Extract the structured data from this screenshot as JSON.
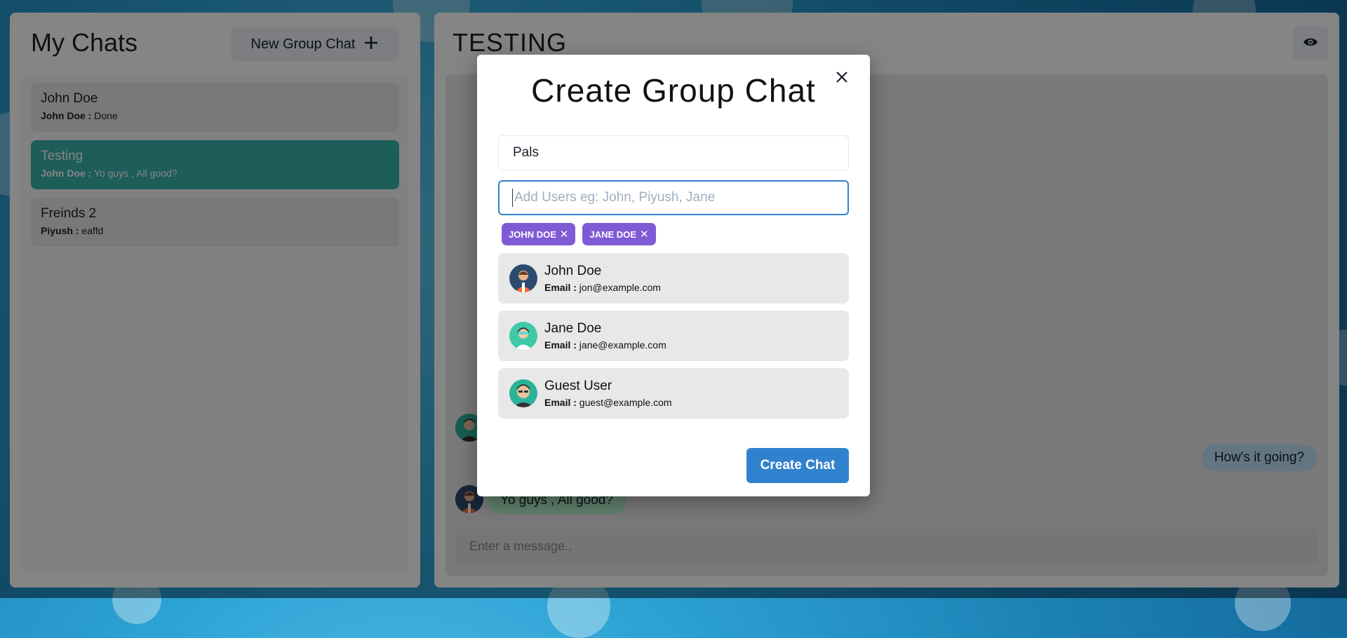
{
  "sidebar": {
    "title": "My Chats",
    "new_group_button": "New Group Chat",
    "chats": [
      {
        "name": "John Doe",
        "sender": "John Doe :",
        "message": "Done"
      },
      {
        "name": "Testing",
        "sender": "John Doe :",
        "message": "Yo guys , All good?"
      },
      {
        "name": "Freinds 2",
        "sender": "Piyush :",
        "message": "eaffd"
      }
    ]
  },
  "chatbox": {
    "title": "TESTING",
    "messages": [
      {
        "text": "How's it going?"
      },
      {
        "text": "Yo guys , All good?"
      }
    ],
    "input_placeholder": "Enter a message.."
  },
  "modal": {
    "title": "Create Group Chat",
    "chat_name_value": "Pals",
    "users_placeholder": "Add Users eg: John, Piyush, Jane",
    "selected_users": [
      {
        "label": "JOHN DOE"
      },
      {
        "label": "JANE DOE"
      }
    ],
    "search_results": [
      {
        "name": "John Doe",
        "email_label": "Email :",
        "email": "jon@example.com"
      },
      {
        "name": "Jane Doe",
        "email_label": "Email :",
        "email": "jane@example.com"
      },
      {
        "name": "Guest User",
        "email_label": "Email :",
        "email": "guest@example.com"
      }
    ],
    "create_button": "Create Chat"
  },
  "colors": {
    "active_chat": "#38b2ac",
    "badge": "#805ad5",
    "primary_button": "#3182ce",
    "input_focus": "#3182ce"
  },
  "icons": {
    "plus": "plus-icon",
    "eye": "eye-icon",
    "close": "close-icon",
    "badge_remove": "close-icon"
  }
}
